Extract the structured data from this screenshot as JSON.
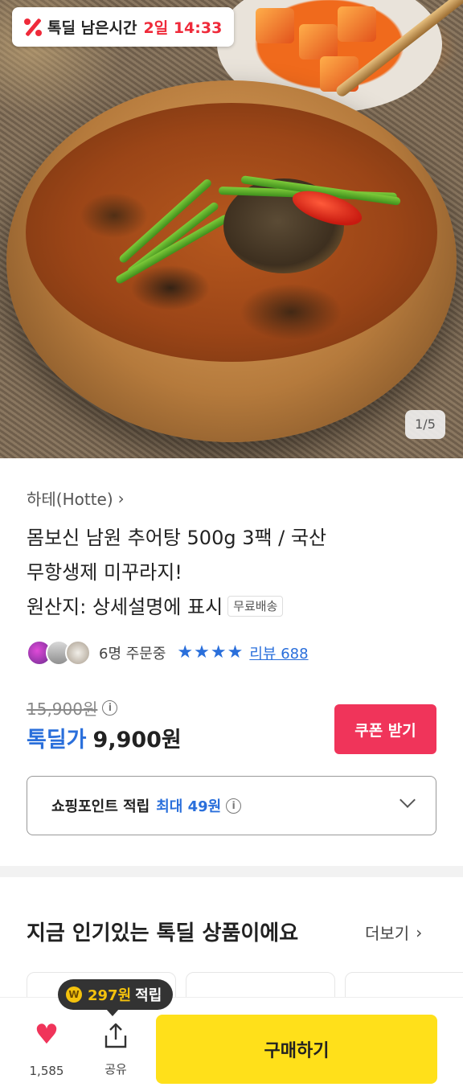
{
  "deal_timer": {
    "label": "톡딜 남은시간",
    "time": "2일 14:33",
    "icon": "percent-icon"
  },
  "gallery": {
    "counter": "1/5"
  },
  "product": {
    "brand": "하테(Hotte)",
    "title_line1": "몸보신 남원 추어탕 500g 3팩 / 국산",
    "title_line2": "무항생제 미꾸라지!",
    "title_line3": "원산지: 상세설명에 표시",
    "shipping_badge": "무료배송",
    "ordering_count": "6명 주문중",
    "rating_stars": 4,
    "review_link": "리뷰 688",
    "original_price": "15,900원",
    "deal_label": "톡딜가",
    "deal_price": "9,900원",
    "coupon_button": "쿠폰 받기",
    "points_label": "쇼핑포인트 적립",
    "points_max": "최대 49원"
  },
  "popular": {
    "title": "지금 인기있는 톡딜 상품이에요",
    "more": "더보기"
  },
  "bottom_bar": {
    "like_count": "1,585",
    "share_label": "공유",
    "buy_label": "구매하기",
    "reward_amount": "297원",
    "reward_label": "적립",
    "coin_symbol": "W"
  },
  "colors": {
    "accent_red": "#ef2a3a",
    "accent_blue": "#2a6fdb",
    "coupon_pink": "#f0345a",
    "buy_yellow": "#ffe01a"
  }
}
